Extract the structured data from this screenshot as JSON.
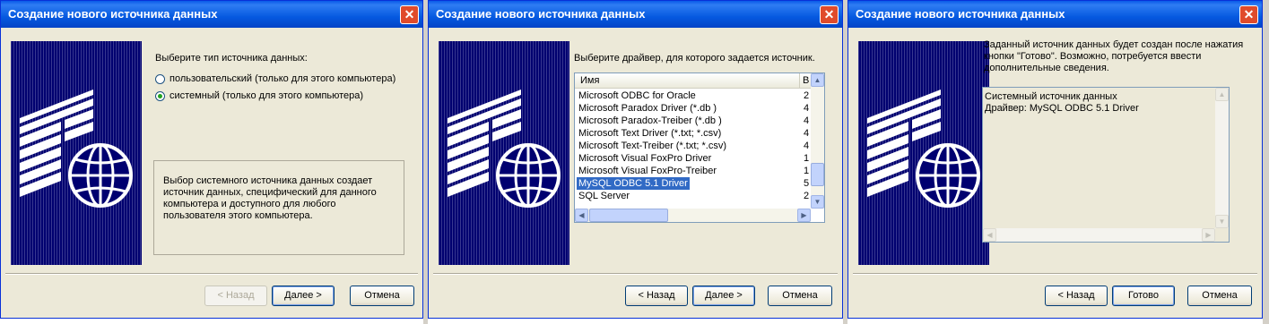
{
  "dialogs": [
    {
      "title": "Создание нового источника данных",
      "prompt": "Выберите тип источника данных:",
      "options": [
        {
          "label": "пользовательский (только для этого компьютера)",
          "selected": false
        },
        {
          "label": "системный (только для этого компьютера)",
          "selected": true
        }
      ],
      "description": "Выбор системного источника данных создает источник данных, специфический для данного компьютера и доступного для любого пользователя этого компьютера.",
      "buttons": {
        "back": "< Назад",
        "next": "Далее >",
        "cancel": "Отмена"
      }
    },
    {
      "title": "Создание нового источника данных",
      "prompt": "Выберите драйвер, для которого задается источник.",
      "columns": [
        "Имя",
        "В"
      ],
      "rows": [
        {
          "name": "Microsoft ODBC for Oracle",
          "ver": "2"
        },
        {
          "name": "Microsoft Paradox Driver (*.db )",
          "ver": "4"
        },
        {
          "name": "Microsoft Paradox-Treiber (*.db )",
          "ver": "4"
        },
        {
          "name": "Microsoft Text Driver (*.txt; *.csv)",
          "ver": "4"
        },
        {
          "name": "Microsoft Text-Treiber (*.txt; *.csv)",
          "ver": "4"
        },
        {
          "name": "Microsoft Visual FoxPro Driver",
          "ver": "1"
        },
        {
          "name": "Microsoft Visual FoxPro-Treiber",
          "ver": "1"
        },
        {
          "name": "MySQL ODBC 5.1 Driver",
          "ver": "5"
        },
        {
          "name": "SQL Server",
          "ver": "2"
        }
      ],
      "selected_row": "MySQL ODBC 5.1 Driver",
      "buttons": {
        "back": "< Назад",
        "next": "Далее >",
        "cancel": "Отмена"
      }
    },
    {
      "title": "Создание нового источника данных",
      "prompt": "Заданный источник данных будет создан после нажатия кнопки \"Готово\".  Возможно, потребуется ввести дополнительные сведения.",
      "summary_line1": "Системный источник данных",
      "summary_line2": "Драйвер:  MySQL ODBC 5.1 Driver",
      "buttons": {
        "back": "< Назад",
        "finish": "Готово",
        "cancel": "Отмена"
      }
    }
  ],
  "colors": {
    "titlebar": "#0559e0",
    "selection": "#316ac5",
    "banner": "#000070",
    "dialog_bg": "#ece9d8"
  }
}
